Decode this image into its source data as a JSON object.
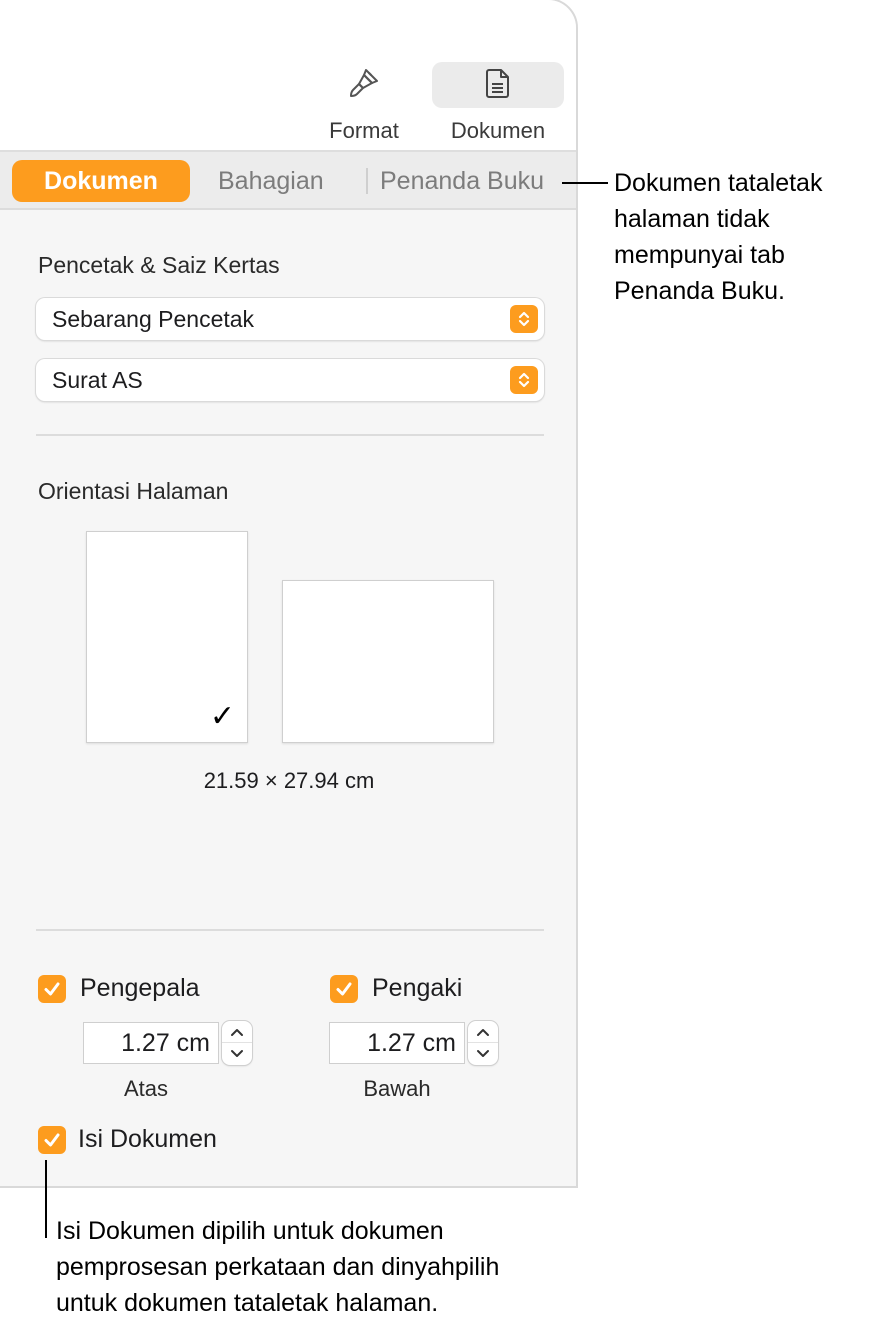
{
  "toolbar": {
    "format_label": "Format",
    "format_icon": "paintbrush-icon",
    "dokumen_label": "Dokumen",
    "dokumen_icon": "document-icon"
  },
  "tabs": {
    "items": [
      {
        "label": "Dokumen",
        "active": true
      },
      {
        "label": "Bahagian",
        "active": false
      },
      {
        "label": "Penanda Buku",
        "active": false
      }
    ]
  },
  "printer_section": {
    "heading": "Pencetak & Saiz Kertas",
    "printer_value": "Sebarang Pencetak",
    "paper_value": "Surat AS"
  },
  "orientation": {
    "heading": "Orientasi Halaman",
    "selected": "portrait",
    "dimensions": "21.59 × 27.94 cm"
  },
  "header_footer": {
    "header_label": "Pengepala",
    "header_checked": true,
    "header_value": "1.27 cm",
    "header_sub": "Atas",
    "footer_label": "Pengaki",
    "footer_checked": true,
    "footer_value": "1.27 cm",
    "footer_sub": "Bawah"
  },
  "body_option": {
    "label": "Isi Dokumen",
    "checked": true
  },
  "callouts": {
    "tab_note": [
      "Dokumen tataletak",
      "halaman tidak",
      "mempunyai tab",
      "Penanda Buku."
    ],
    "body_note": [
      "Isi Dokumen dipilih untuk dokumen",
      "pemprosesan perkataan dan dinyahpilih",
      "untuk dokumen tataletak halaman."
    ]
  },
  "colors": {
    "accent": "#fd9c1e",
    "panel_bg": "#f6f6f6"
  }
}
